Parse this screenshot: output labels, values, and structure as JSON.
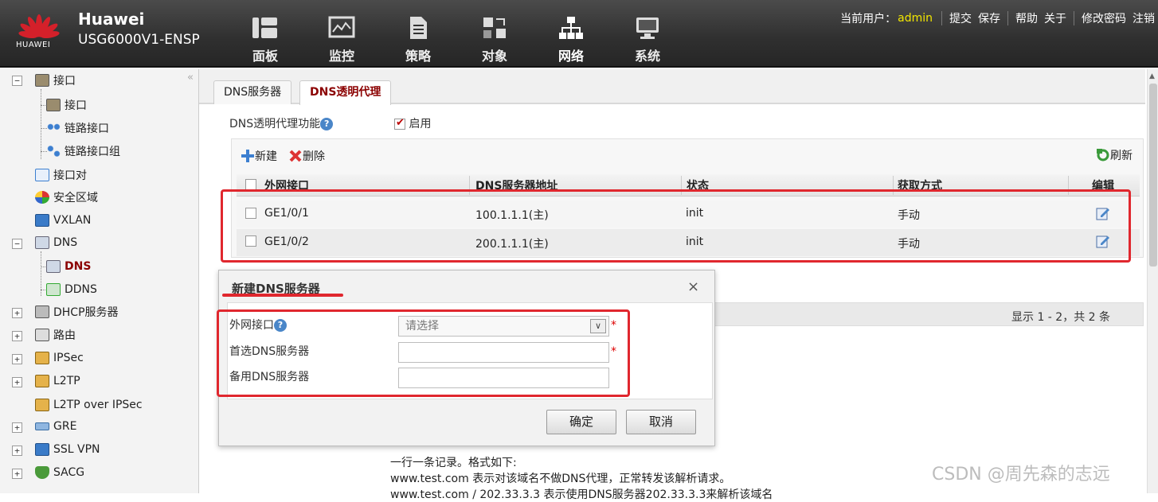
{
  "brand": {
    "logo_text": "HUAWEI",
    "name": "Huawei",
    "model": "USG6000V1-ENSP"
  },
  "nav": [
    {
      "label": "面板",
      "icon": "dashboard-icon"
    },
    {
      "label": "监控",
      "icon": "monitor-icon"
    },
    {
      "label": "策略",
      "icon": "policy-icon"
    },
    {
      "label": "对象",
      "icon": "object-icon"
    },
    {
      "label": "网络",
      "icon": "network-icon"
    },
    {
      "label": "系统",
      "icon": "system-icon"
    }
  ],
  "user": {
    "label": "当前用户：",
    "name": "admin",
    "links": [
      "提交",
      "保存",
      "帮助",
      "关于",
      "修改密码",
      "注销"
    ]
  },
  "tree": [
    {
      "label": "接口",
      "expand": "−"
    },
    {
      "label": "接口"
    },
    {
      "label": "链路接口"
    },
    {
      "label": "链路接口组"
    },
    {
      "label": "接口对"
    },
    {
      "label": "安全区域"
    },
    {
      "label": "VXLAN"
    },
    {
      "label": "DNS",
      "expand": "−"
    },
    {
      "label": "DNS"
    },
    {
      "label": "DDNS"
    },
    {
      "label": "DHCP服务器",
      "expand": "+"
    },
    {
      "label": "路由",
      "expand": "+"
    },
    {
      "label": "IPSec",
      "expand": "+"
    },
    {
      "label": "L2TP",
      "expand": "+"
    },
    {
      "label": "L2TP over IPSec"
    },
    {
      "label": "GRE",
      "expand": "+"
    },
    {
      "label": "SSL VPN",
      "expand": "+"
    },
    {
      "label": "SACG",
      "expand": "+"
    }
  ],
  "tabs": [
    "DNS服务器",
    "DNS透明代理"
  ],
  "proxy_toggle": {
    "label": "DNS透明代理功能",
    "help": "?",
    "checkbox_label": "启用",
    "checked": true
  },
  "toolbar": {
    "new_label": "新建",
    "delete_label": "删除",
    "refresh_label": "刷新"
  },
  "table": {
    "headers": [
      "外网接口",
      "DNS服务器地址",
      "状态",
      "获取方式",
      "编辑"
    ],
    "rows": [
      [
        "GE1/0/1",
        "100.1.1.1(主)",
        "init",
        "手动"
      ],
      [
        "GE1/0/2",
        "200.1.1.1(主)",
        "init",
        "手动"
      ]
    ]
  },
  "pager": "显示 1 - 2，共 2 条",
  "dialog": {
    "title": "新建DNS服务器",
    "close": "×",
    "fields": [
      {
        "label": "外网接口",
        "placeholder": "请选择",
        "required": "*",
        "help": "?"
      },
      {
        "label": "首选DNS服务器",
        "placeholder": "",
        "required": "*"
      },
      {
        "label": "备用DNS服务器",
        "placeholder": ""
      }
    ],
    "ok": "确定",
    "cancel": "取消"
  },
  "help_lines": [
    "一行一条记录。格式如下:",
    "www.test.com 表示对该域名不做DNS代理，正常转发该解析请求。",
    "www.test.com / 202.33.3.3 表示使用DNS服务器202.33.3.3来解析该域名"
  ],
  "watermark": "CSDN @周先森的志远"
}
